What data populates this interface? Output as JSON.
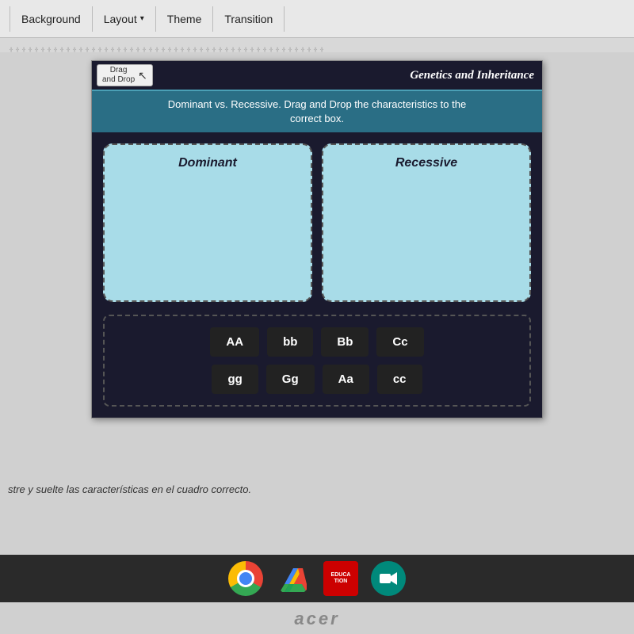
{
  "toolbar": {
    "background_label": "Background",
    "layout_label": "Layout",
    "theme_label": "Theme",
    "transition_label": "Transition"
  },
  "slide": {
    "drag_drop_btn_label": "Drag\nand Drop",
    "title": "Genetics and Inheritance",
    "subtitle_line1": "Dominant vs. Recessive. Drag and Drop the characteristics to the",
    "subtitle_line2": "correct box.",
    "dominant_label": "Dominant",
    "recessive_label": "Recessive",
    "items_row1": [
      "AA",
      "bb",
      "Bb",
      "Cc"
    ],
    "items_row2": [
      "gg",
      "Gg",
      "Aa",
      "cc"
    ]
  },
  "bottom_text": "stre y suelte las características en el cuadro correcto.",
  "acer_brand": "acer"
}
